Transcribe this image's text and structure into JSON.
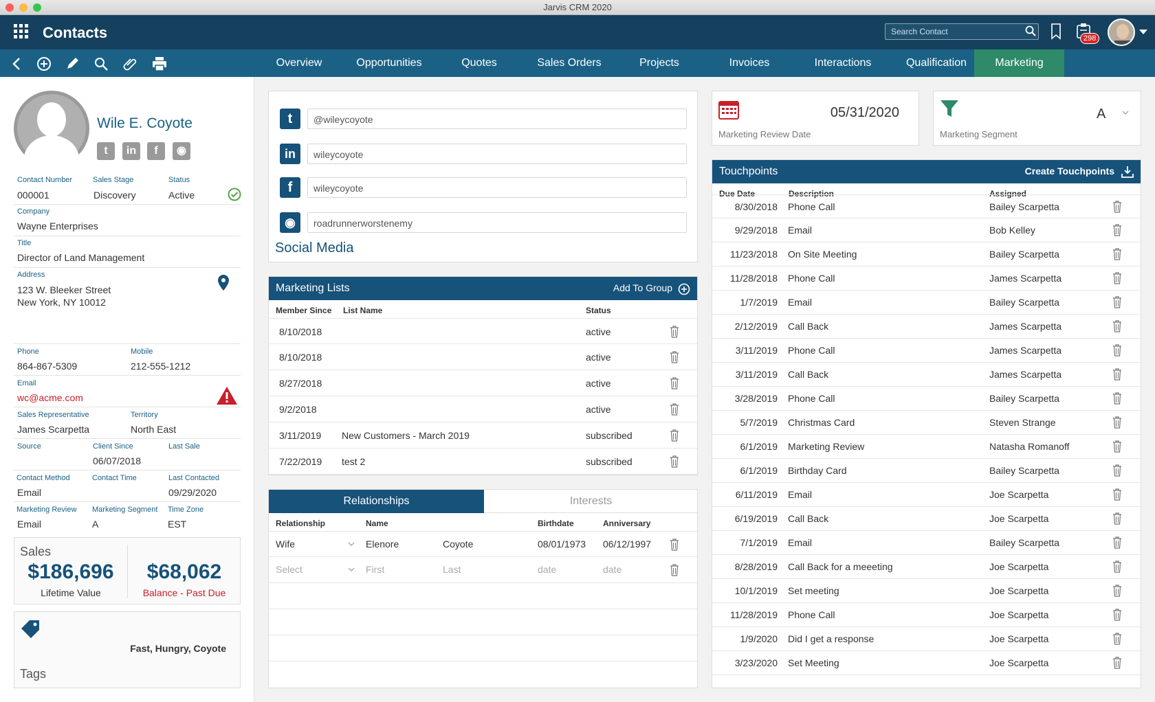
{
  "window": {
    "title": "Jarvis CRM 2020"
  },
  "header": {
    "title": "Contacts",
    "search_placeholder": "Search Contact",
    "notification_count": "298"
  },
  "tabs": [
    "Overview",
    "Opportunities",
    "Quotes",
    "Sales Orders",
    "Projects",
    "Invoices",
    "Interactions",
    "Qualification",
    "Marketing"
  ],
  "contact": {
    "name": "Wile E. Coyote",
    "contact_number_label": "Contact Number",
    "contact_number": "000001",
    "sales_stage_label": "Sales Stage",
    "sales_stage": "Discovery",
    "status_label": "Status",
    "status": "Active",
    "company_label": "Company",
    "company": "Wayne Enterprises",
    "title_label": "Title",
    "title": "Director of Land Management",
    "address_label": "Address",
    "address_line1": "123 W. Bleeker Street",
    "address_line2": "New York, NY 10012",
    "phone_label": "Phone",
    "phone": "864-867-5309",
    "mobile_label": "Mobile",
    "mobile": "212-555-1212",
    "email_label": "Email",
    "email": "wc@acme.com",
    "sales_rep_label": "Sales Representative",
    "sales_rep": "James Scarpetta",
    "territory_label": "Territory",
    "territory": "North East",
    "source_label": "Source",
    "source": "",
    "client_since_label": "Client Since",
    "client_since": "06/07/2018",
    "last_sale_label": "Last Sale",
    "last_sale": "",
    "contact_method_label": "Contact Method",
    "contact_method": "Email",
    "contact_time_label": "Contact Time",
    "contact_time": "",
    "last_contacted_label": "Last Contacted",
    "last_contacted": "09/29/2020",
    "marketing_review_label": "Marketing Review",
    "marketing_review": "Email",
    "marketing_segment_label": "Marketing Segment",
    "marketing_segment": "A",
    "time_zone_label": "Time Zone",
    "time_zone": "EST"
  },
  "sales": {
    "title": "Sales",
    "lifetime_value": "$186,696",
    "lifetime_label": "Lifetime Value",
    "balance": "$68,062",
    "balance_label": "Balance - Past Due"
  },
  "tags": {
    "title": "Tags",
    "value": "Fast, Hungry, Coyote"
  },
  "social": {
    "title": "Social Media",
    "twitter": "@wileycoyote",
    "linkedin": "wileycoyote",
    "facebook": "wileycoyote",
    "instagram": "roadrunnerworstenemy"
  },
  "marketing_lists": {
    "title": "Marketing Lists",
    "add_label": "Add To Group",
    "columns": [
      "Member Since",
      "List Name",
      "Status"
    ],
    "rows": [
      {
        "date": "8/10/2018",
        "name": "",
        "status": "active"
      },
      {
        "date": "8/10/2018",
        "name": "",
        "status": "active"
      },
      {
        "date": "8/27/2018",
        "name": "",
        "status": "active"
      },
      {
        "date": "9/2/2018",
        "name": "",
        "status": "active"
      },
      {
        "date": "3/11/2019",
        "name": "New Customers - March 2019",
        "status": "subscribed"
      },
      {
        "date": "7/22/2019",
        "name": "test 2",
        "status": "subscribed"
      }
    ]
  },
  "relationships": {
    "tab_active": "Relationships",
    "tab_inactive": "Interests",
    "columns": [
      "Relationship",
      "Name",
      "Birthdate",
      "Anniversary"
    ],
    "row": {
      "relationship": "Wife",
      "first": "Elenore",
      "last": "Coyote",
      "birthdate": "08/01/1973",
      "anniversary": "06/12/1997"
    },
    "new_row": {
      "relationship": "Select",
      "first": "First",
      "last": "Last",
      "birthdate": "date",
      "anniversary": "date"
    }
  },
  "review": {
    "date": "05/31/2020",
    "label": "Marketing Review Date"
  },
  "segment": {
    "value": "A",
    "label": "Marketing Segment"
  },
  "touchpoints": {
    "title": "Touchpoints",
    "create_label": "Create Touchpoints",
    "columns": [
      "Due Date",
      "Description",
      "Assigned"
    ],
    "rows": [
      {
        "date": "8/30/2018",
        "desc": "Phone Call",
        "assigned": "Bailey Scarpetta"
      },
      {
        "date": "9/29/2018",
        "desc": "Email",
        "assigned": "Bob Kelley"
      },
      {
        "date": "11/23/2018",
        "desc": "On Site Meeting",
        "assigned": "Bailey Scarpetta"
      },
      {
        "date": "11/28/2018",
        "desc": "Phone Call",
        "assigned": "James Scarpetta"
      },
      {
        "date": "1/7/2019",
        "desc": "Email",
        "assigned": "Bailey Scarpetta"
      },
      {
        "date": "2/12/2019",
        "desc": "Call Back",
        "assigned": "James Scarpetta"
      },
      {
        "date": "3/11/2019",
        "desc": "Phone Call",
        "assigned": "James Scarpetta"
      },
      {
        "date": "3/11/2019",
        "desc": "Call Back",
        "assigned": "James Scarpetta"
      },
      {
        "date": "3/28/2019",
        "desc": "Phone Call",
        "assigned": "Bailey Scarpetta"
      },
      {
        "date": "5/7/2019",
        "desc": "Christmas Card",
        "assigned": "Steven Strange"
      },
      {
        "date": "6/1/2019",
        "desc": "Marketing Review",
        "assigned": "Natasha Romanoff"
      },
      {
        "date": "6/1/2019",
        "desc": "Birthday Card",
        "assigned": "Bailey Scarpetta"
      },
      {
        "date": "6/11/2019",
        "desc": "Email",
        "assigned": "Joe Scarpetta"
      },
      {
        "date": "6/19/2019",
        "desc": "Call Back",
        "assigned": "Joe Scarpetta"
      },
      {
        "date": "7/1/2019",
        "desc": "Email",
        "assigned": "Bailey Scarpetta"
      },
      {
        "date": "8/28/2019",
        "desc": "Call Back for a meeeting",
        "assigned": "Joe Scarpetta"
      },
      {
        "date": "10/1/2019",
        "desc": "Set meeting",
        "assigned": "Joe Scarpetta"
      },
      {
        "date": "11/28/2019",
        "desc": "Phone Call",
        "assigned": "Joe Scarpetta"
      },
      {
        "date": "1/9/2020",
        "desc": "Did I get a response",
        "assigned": "Joe Scarpetta"
      },
      {
        "date": "3/23/2020",
        "desc": "Set Meeting",
        "assigned": "Joe Scarpetta"
      }
    ]
  }
}
